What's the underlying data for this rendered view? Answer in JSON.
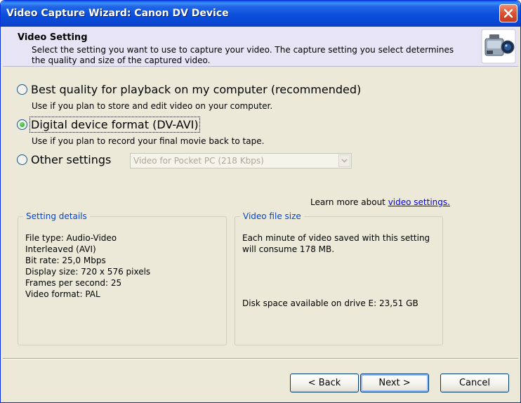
{
  "window": {
    "title": "Video Capture Wizard: Canon DV Device",
    "close_icon": "close-icon"
  },
  "header": {
    "title": "Video Setting",
    "description": "Select the setting you want to use to capture your video. The capture setting you select determines the quality and size of the captured video.",
    "icon": "camcorder-icon"
  },
  "options": [
    {
      "label": "Best quality for playback on my computer (recommended)",
      "hint": "Use if you plan to store and edit video on your computer.",
      "checked": false
    },
    {
      "label": "Digital device format (DV-AVI)",
      "hint": "Use if you plan to record your final movie back to tape.",
      "checked": true
    },
    {
      "label": "Other settings",
      "checked": false
    }
  ],
  "other_settings_select": {
    "value": "Video for Pocket PC (218 Kbps)",
    "enabled": false
  },
  "learn_more": {
    "prefix": "Learn more about ",
    "link": "video settings."
  },
  "setting_details": {
    "legend": "Setting details",
    "lines": [
      "File type: Audio-Video",
      "Interleaved (AVI)",
      "Bit rate: 25,0 Mbps",
      "Display size: 720 x 576 pixels",
      "Frames per second: 25",
      "Video format: PAL"
    ]
  },
  "video_file_size": {
    "legend": "Video file size",
    "line1": "Each minute of video saved with this setting",
    "line2": "will consume 178 MB.",
    "disk_space": "Disk space available on drive E: 23,51 GB"
  },
  "buttons": {
    "back": "< Back",
    "next": "Next >",
    "cancel": "Cancel"
  },
  "colors": {
    "titlebar": "#0a4fdc",
    "dialog_bg": "#ece9d8",
    "header_bg": "#e7e4f5",
    "legend_text": "#0046d5",
    "link": "#0000ee"
  }
}
